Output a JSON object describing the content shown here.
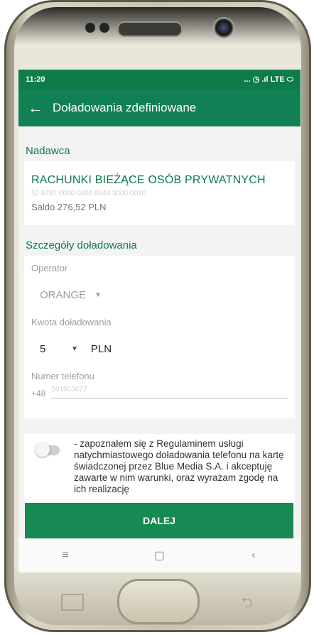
{
  "status_bar": {
    "time": "11:20",
    "icons": "... ◷ .ıl LTE ⬭"
  },
  "app_bar": {
    "back_icon": "←",
    "title": "Doładowania zdefiniowane"
  },
  "sender": {
    "section_title": "Nadawca",
    "account_name": "RACHUNKI BIEŻĄCE OSÓB PRYWATNYCH",
    "account_number": "52 8787 0000 0000 0044 3000 0010",
    "balance": "Saldo 276,52 PLN"
  },
  "details": {
    "section_title": "Szczegóły doładowania",
    "operator_label": "Operator",
    "operator_value": "ORANGE",
    "amount_label": "Kwota doładowania",
    "amount_value": "5",
    "currency": "PLN",
    "phone_label": "Numer telefonu",
    "phone_prefix": "+48",
    "phone_value": "501953677"
  },
  "consent": {
    "text": "- zapoznałem się z Regulaminem usługi natychmiastowego doładowania telefonu na kartę świadczonej przez Blue Media S.A. i akceptuję zawarte w nim warunki, oraz wyrażam zgodę na ich realizację"
  },
  "actions": {
    "next_label": "DALEJ"
  },
  "nav": {
    "menu_icon": "≡",
    "home_icon": "▢",
    "back_icon": "‹"
  },
  "colors": {
    "primary": "#118055",
    "button": "#168a52"
  }
}
